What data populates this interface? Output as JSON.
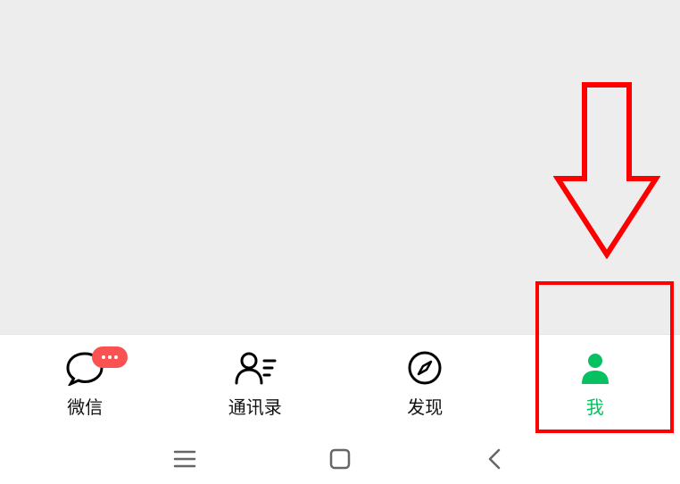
{
  "tabs": {
    "chat": {
      "label": "微信",
      "icon": "chat-icon",
      "hasBadge": true
    },
    "contacts": {
      "label": "通讯录",
      "icon": "contact-icon"
    },
    "discover": {
      "label": "发现",
      "icon": "compass-icon"
    },
    "me": {
      "label": "我",
      "icon": "person-icon",
      "active": true
    }
  },
  "colors": {
    "accent": "#07c160",
    "badge": "#fa5151",
    "annotation": "#ff0000"
  }
}
